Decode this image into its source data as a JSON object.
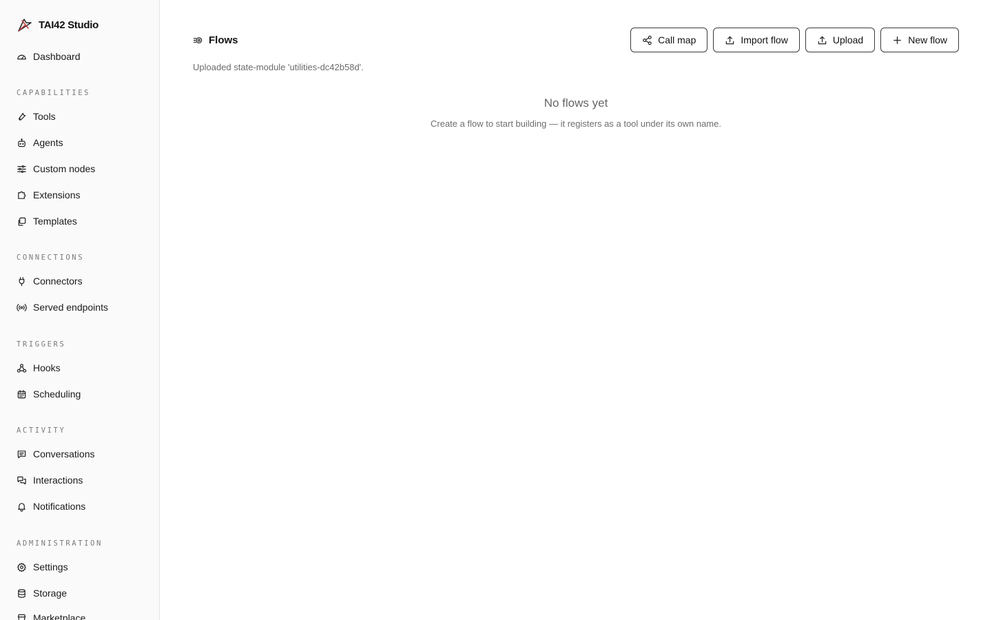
{
  "app": {
    "name": "TAI42 Studio",
    "logo_icon": "pen-nib-icon"
  },
  "sidebar": {
    "dashboard": {
      "label": "Dashboard",
      "icon": "gauge-icon"
    },
    "sections": {
      "capabilities": {
        "title": "CAPABILITIES",
        "items": [
          {
            "label": "Tools",
            "icon": "wrench-icon"
          },
          {
            "label": "Agents",
            "icon": "bot-icon"
          },
          {
            "label": "Custom nodes",
            "icon": "sliders-icon"
          },
          {
            "label": "Extensions",
            "icon": "puzzle-icon"
          },
          {
            "label": "Templates",
            "icon": "copy-icon"
          }
        ]
      },
      "connections": {
        "title": "CONNECTIONS",
        "items": [
          {
            "label": "Connectors",
            "icon": "plug-icon"
          },
          {
            "label": "Served endpoints",
            "icon": "radio-icon"
          }
        ]
      },
      "triggers": {
        "title": "TRIGGERS",
        "items": [
          {
            "label": "Hooks",
            "icon": "webhook-icon"
          },
          {
            "label": "Scheduling",
            "icon": "calendar-icon"
          }
        ]
      },
      "activity": {
        "title": "ACTIVITY",
        "items": [
          {
            "label": "Conversations",
            "icon": "message-square-icon"
          },
          {
            "label": "Interactions",
            "icon": "messages-icon"
          },
          {
            "label": "Notifications",
            "icon": "bell-icon"
          }
        ]
      },
      "administration": {
        "title": "ADMINISTRATION",
        "items": [
          {
            "label": "Settings",
            "icon": "gear-icon"
          },
          {
            "label": "Storage",
            "icon": "database-icon"
          },
          {
            "label": "Marketplace",
            "icon": "store-icon"
          }
        ]
      }
    }
  },
  "header": {
    "title": "Flows",
    "title_icon": "flow-icon",
    "buttons": {
      "call_map": {
        "label": "Call map",
        "icon": "share-icon"
      },
      "import_flow": {
        "label": "Import flow",
        "icon": "upload-icon"
      },
      "upload": {
        "label": "Upload",
        "icon": "upload-icon"
      },
      "new_flow": {
        "label": "New flow",
        "icon": "plus-icon"
      }
    }
  },
  "status_message": "Uploaded state-module 'utilities-dc42b58d'.",
  "empty_state": {
    "title": "No flows yet",
    "description": "Create a flow to start building — it registers as a tool under its own name."
  }
}
